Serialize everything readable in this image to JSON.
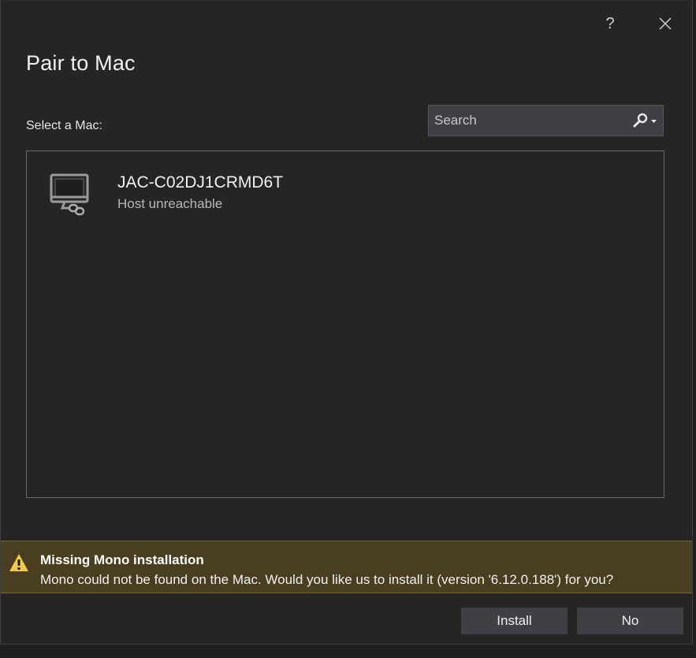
{
  "dialog": {
    "title": "Pair to Mac",
    "help_label": "?",
    "select_label": "Select a Mac:"
  },
  "search": {
    "placeholder": "Search",
    "icon": "search-icon"
  },
  "macs": [
    {
      "name": "JAC-C02DJ1CRMD6T",
      "status": "Host unreachable",
      "icon": "mac-disconnected-icon"
    }
  ],
  "infobar": {
    "icon": "warning-icon",
    "title": "Missing Mono installation",
    "message": "Mono could not be found on the Mac. Would you like us to install it (version '6.12.0.188') for you?"
  },
  "buttons": {
    "install": "Install",
    "no": "No"
  },
  "colors": {
    "background": "#252526",
    "infobar": "#493e1f",
    "warning": "#f2c94c",
    "button": "#3f3f46"
  }
}
